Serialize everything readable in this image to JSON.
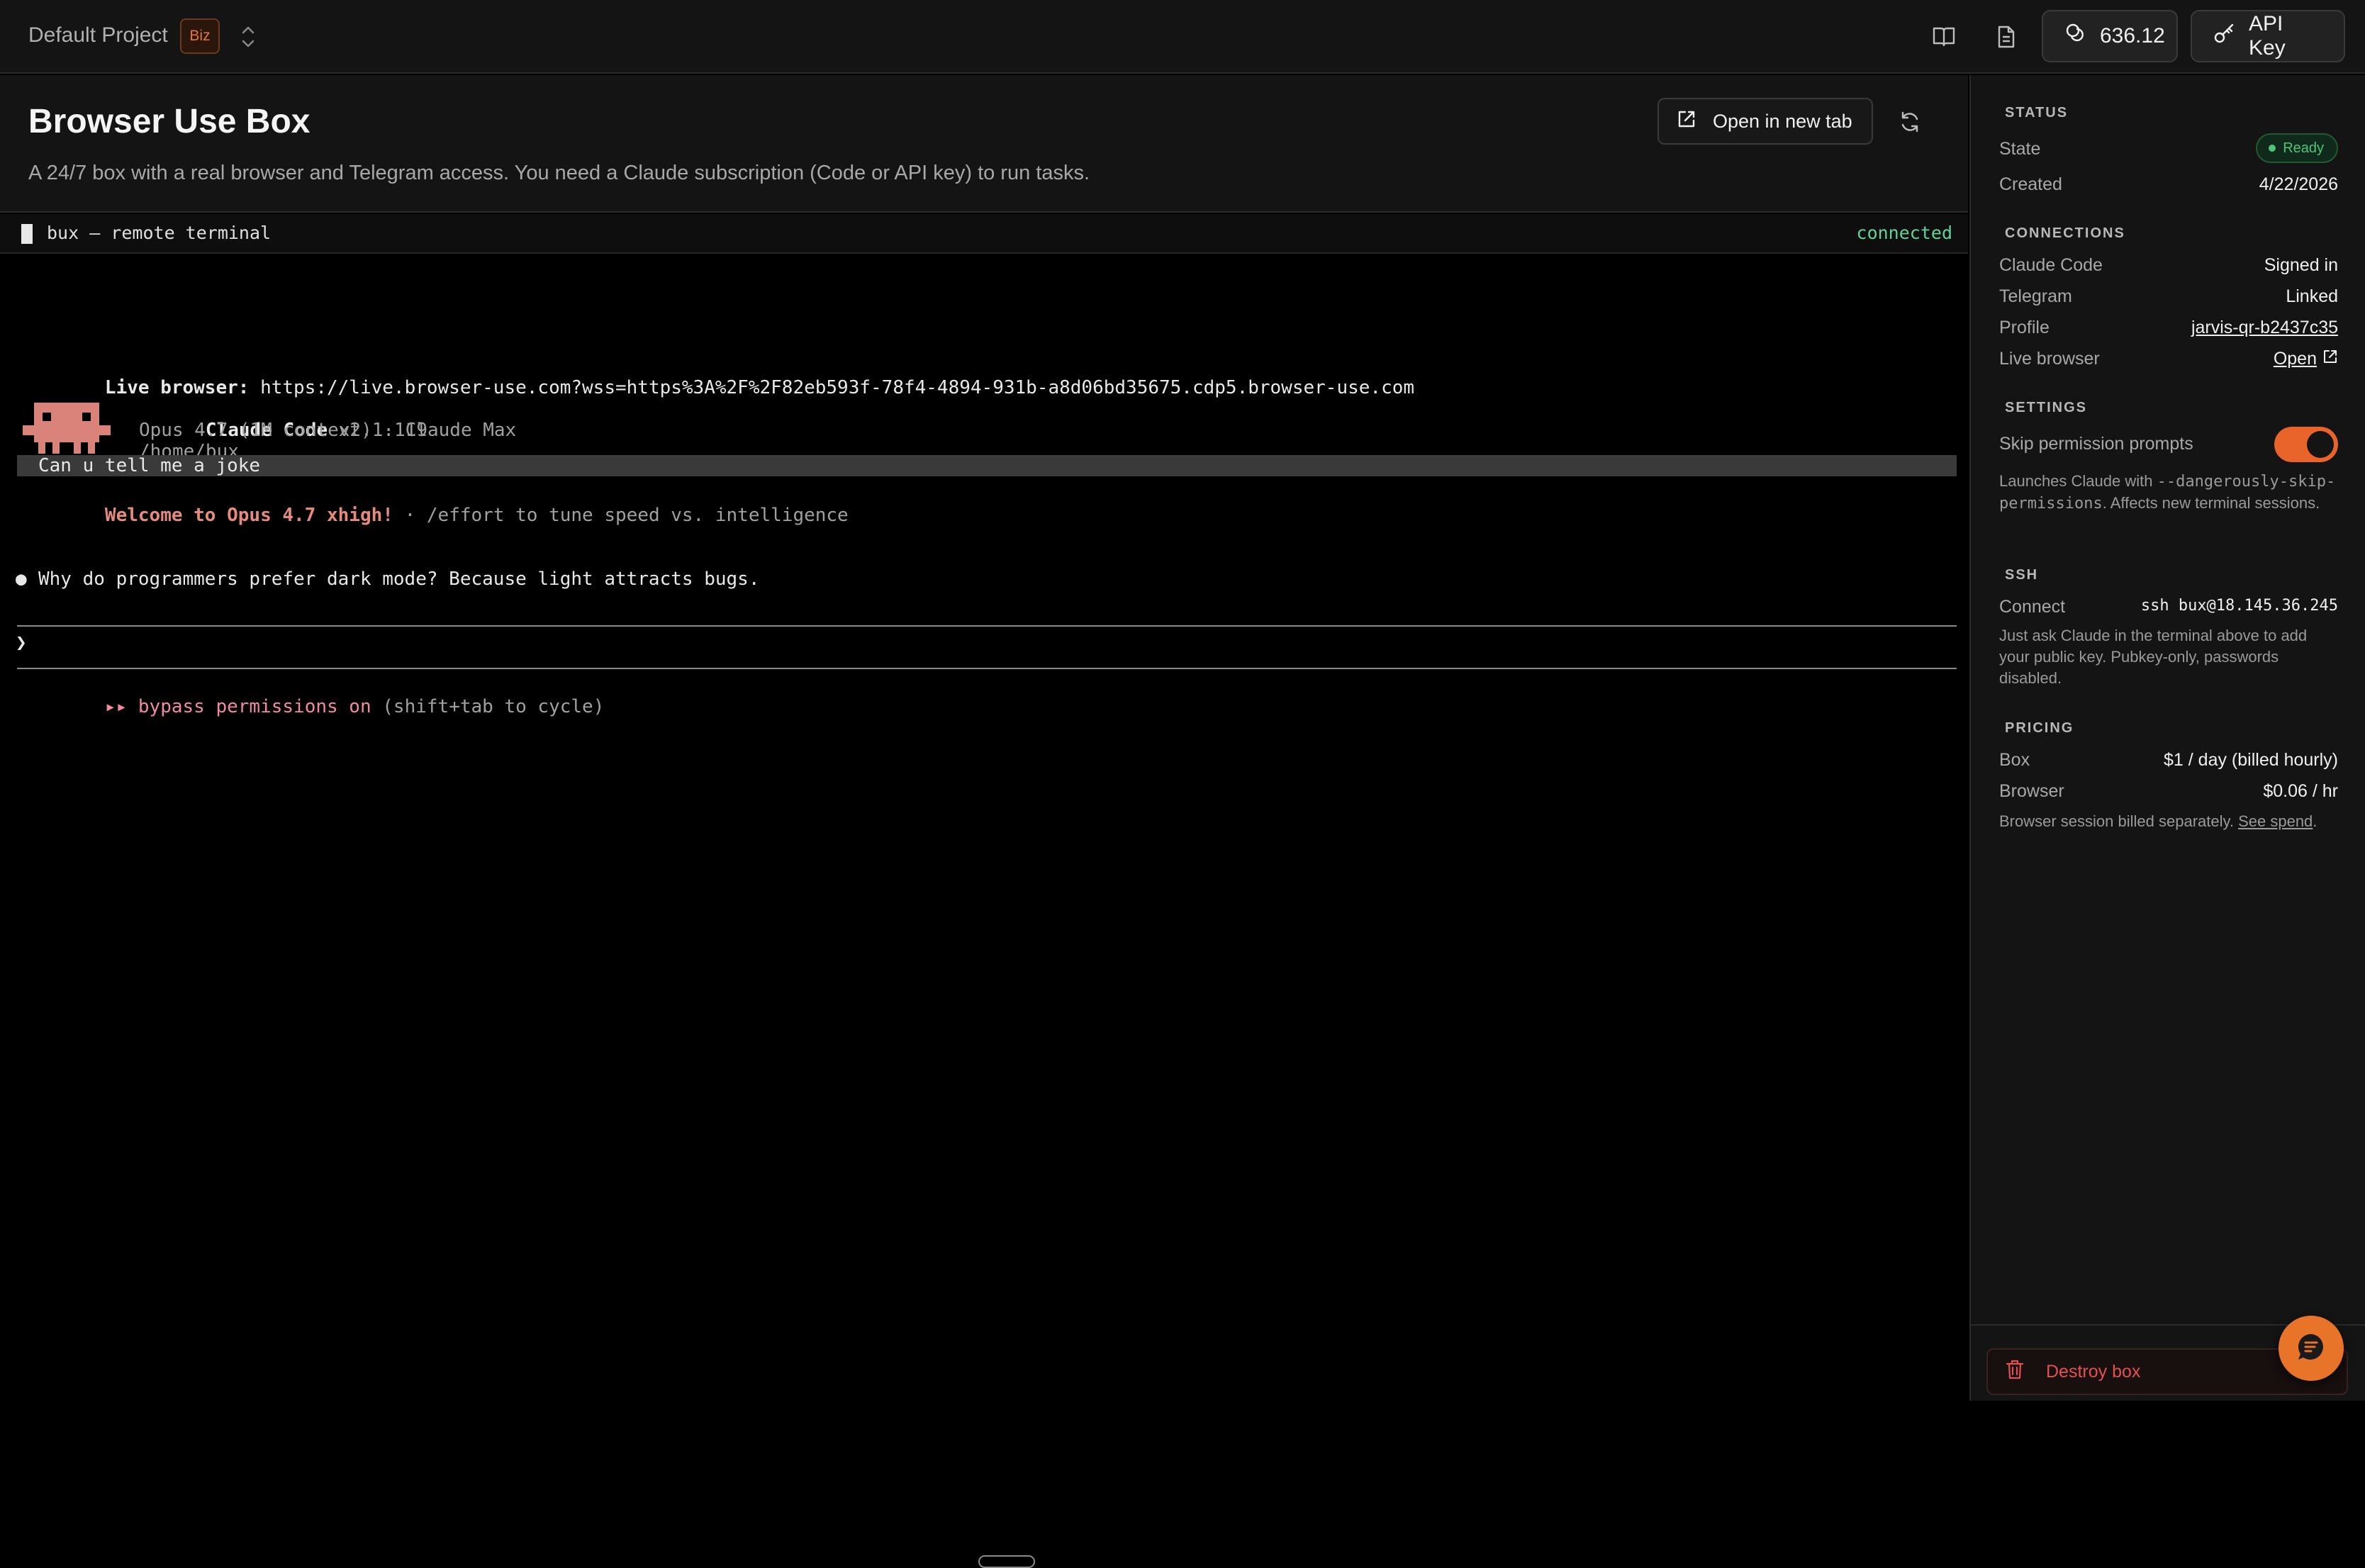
{
  "topbar": {
    "project_name": "Default Project",
    "plan_badge": "Biz",
    "credits": "636.12",
    "api_key_label": "API Key"
  },
  "header": {
    "title": "Browser Use Box",
    "description": "A 24/7 box with a real browser and Telegram access. You need a Claude subscription (Code or API key) to run tasks.",
    "open_tab_label": "Open in new tab"
  },
  "terminal_bar": {
    "title": "bux — remote terminal",
    "status": "connected"
  },
  "terminal": {
    "live_browser_label": "Live browser:",
    "live_browser_url": "https://live.browser-use.com?wss=https%3A%2F%2F82eb593f-78f4-4894-931b-a8d06bd35675.cdp5.browser-use.com",
    "app_name": "Claude Code",
    "app_version": "v2.1.119",
    "model_line": "Opus 4.7 (1M context) · Claude Max",
    "cwd": "/home/bux",
    "welcome": "Welcome to Opus 4.7 xhigh!",
    "welcome_hint": " · /effort to tune speed vs. intelligence",
    "user_prompt": "Can u tell me a joke",
    "response_bullet": "●",
    "response": "Why do programmers prefer dark mode? Because light attracts bugs.",
    "input_caret": "❯",
    "mode_arrows": "▸▸",
    "mode_label": "bypass permissions on",
    "mode_hint": " (shift+tab to cycle)"
  },
  "sidebar": {
    "status": {
      "title": "STATUS",
      "state_label": "State",
      "state_value": "Ready",
      "created_label": "Created",
      "created_value": "4/22/2026"
    },
    "connections": {
      "title": "CONNECTIONS",
      "claude_label": "Claude Code",
      "claude_value": "Signed in",
      "telegram_label": "Telegram",
      "telegram_value": "Linked",
      "profile_label": "Profile",
      "profile_value": "jarvis-qr-b2437c35",
      "live_label": "Live browser",
      "live_value": "Open"
    },
    "settings": {
      "title": "SETTINGS",
      "skip_label": "Skip permission prompts",
      "skip_enabled": true,
      "note_pre": "Launches Claude with ",
      "note_flag": "--dangerously-skip-permissions",
      "note_post": ". Affects new terminal sessions."
    },
    "ssh": {
      "title": "SSH",
      "connect_label": "Connect",
      "connect_value": "ssh bux@18.145.36.245",
      "note": "Just ask Claude in the terminal above to add your public key. Pubkey-only, passwords disabled."
    },
    "pricing": {
      "title": "PRICING",
      "box_label": "Box",
      "box_value": "$1 / day (billed hourly)",
      "browser_label": "Browser",
      "browser_value": "$0.06 / hr",
      "note_pre": "Browser session billed separately. ",
      "note_link": "See spend",
      "note_post": "."
    },
    "destroy_label": "Destroy box"
  },
  "colors": {
    "accent": "#e8742a",
    "ready": "#4fc47a",
    "danger": "#e45050",
    "claude_salmon": "#e58a7c"
  }
}
